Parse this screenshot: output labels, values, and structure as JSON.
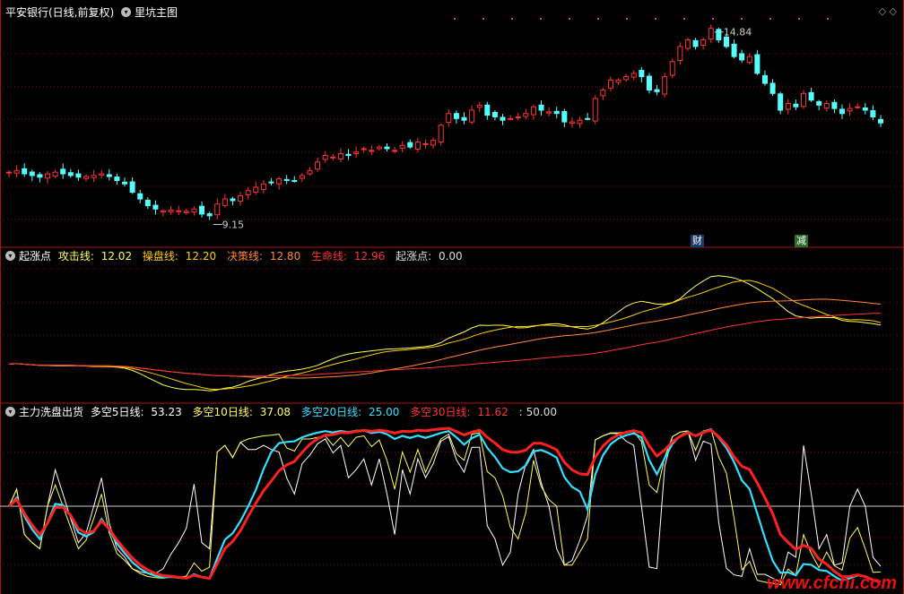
{
  "main_panel": {
    "title": "平安银行(日线,前复权)",
    "indicator": "里坑主图",
    "high_label": "14.84",
    "low_label": "9.15",
    "badge_cai": "财",
    "badge_jian": "减"
  },
  "panel2": {
    "title": "起涨点",
    "items": [
      {
        "label": "攻击线:",
        "value": "12.02",
        "color": "#ffff55"
      },
      {
        "label": "操盘线:",
        "value": "12.20",
        "color": "#ffcc00"
      },
      {
        "label": "决策线:",
        "value": "12.80",
        "color": "#ff8833"
      },
      {
        "label": "生命线:",
        "value": "12.96",
        "color": "#ff3333"
      },
      {
        "label": "起涨点:",
        "value": "0.00",
        "color": "#dddddd"
      }
    ]
  },
  "panel3": {
    "title": "主力洗盘出货",
    "items": [
      {
        "label": "多空5日线:",
        "value": "53.23",
        "color": "#ffffff"
      },
      {
        "label": "多空10日线:",
        "value": "37.08",
        "color": "#ffff55"
      },
      {
        "label": "多空20日线:",
        "value": "25.00",
        "color": "#33e0ff"
      },
      {
        "label": "多空30日线:",
        "value": "11.62",
        "color": "#ff3333"
      },
      {
        "label": ":",
        "value": "50.00",
        "color": "#dddddd"
      }
    ]
  },
  "watermark": "www.cfchi.com",
  "colors": {
    "up": "#ff3232",
    "down": "#54ffff",
    "grid": "#8b0000"
  },
  "chart_data": [
    {
      "type": "candlestick",
      "title": "平安银行(日线,前复权)",
      "close": [
        10.55,
        10.6,
        10.5,
        10.45,
        10.4,
        10.5,
        10.55,
        10.5,
        10.45,
        10.4,
        10.42,
        10.45,
        10.5,
        10.42,
        10.3,
        10.2,
        9.95,
        9.75,
        9.55,
        9.45,
        9.4,
        9.42,
        9.4,
        9.38,
        9.45,
        9.3,
        9.25,
        9.6,
        9.75,
        9.7,
        9.85,
        10.0,
        10.1,
        10.2,
        10.25,
        10.35,
        10.3,
        10.3,
        10.45,
        10.6,
        10.85,
        11.05,
        11.0,
        11.1,
        11.05,
        11.15,
        11.25,
        11.2,
        11.3,
        11.25,
        11.2,
        11.35,
        11.3,
        11.45,
        11.4,
        11.5,
        11.95,
        12.3,
        12.15,
        12.1,
        12.4,
        12.55,
        12.25,
        12.2,
        12.1,
        12.15,
        12.2,
        12.3,
        12.5,
        12.4,
        12.35,
        12.3,
        12.05,
        12.05,
        12.1,
        12.15,
        12.75,
        13.0,
        13.3,
        13.3,
        13.4,
        13.5,
        13.4,
        13.0,
        12.95,
        13.4,
        13.85,
        14.3,
        14.5,
        14.3,
        14.5,
        14.84,
        14.5,
        14.3,
        14.0,
        13.9,
        14.0,
        13.5,
        13.2,
        12.9,
        12.4,
        12.6,
        12.5,
        12.9,
        12.7,
        12.55,
        12.6,
        12.45,
        12.3,
        12.45,
        12.5,
        12.4,
        12.2,
        12.02
      ],
      "high_label": 14.84,
      "low_label": 9.15
    },
    {
      "type": "line",
      "title": "起涨点",
      "series": [
        {
          "name": "攻击线",
          "last": 12.02
        },
        {
          "name": "操盘线",
          "last": 12.2
        },
        {
          "name": "决策线",
          "last": 12.8
        },
        {
          "name": "生命线",
          "last": 12.96
        },
        {
          "name": "起涨点",
          "last": 0.0
        }
      ]
    },
    {
      "type": "line",
      "title": "主力洗盘出货",
      "ylim": [
        0,
        100
      ],
      "reference": 50,
      "series": [
        {
          "name": "多空5日线",
          "last": 53.23
        },
        {
          "name": "多空10日线",
          "last": 37.08
        },
        {
          "name": "多空20日线",
          "last": 25.0
        },
        {
          "name": "多空30日线",
          "last": 11.62
        }
      ]
    }
  ]
}
